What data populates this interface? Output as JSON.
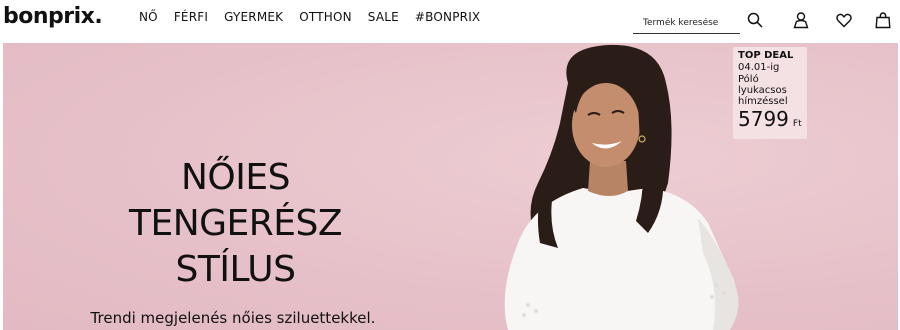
{
  "header": {
    "logo": "bonprix.",
    "nav": [
      "NŐ",
      "FÉRFI",
      "GYERMEK",
      "OTTHON",
      "SALE",
      "#BONPRIX"
    ],
    "search": {
      "placeholder": "Termék keresése",
      "value": ""
    }
  },
  "hero": {
    "title_lines": [
      "NŐIES",
      "TENGERÉSZ",
      "STÍLUS"
    ],
    "subtitle": "Trendi megjelenés nőies sziluettekkel.",
    "deal": {
      "label": "TOP DEAL",
      "date": "04.01-ig",
      "product_lines": [
        "Póló",
        "lyukacsos",
        "hímzéssel"
      ],
      "price": "5799",
      "currency": "Ft"
    }
  },
  "colors": {
    "hero_background": "#e9c6cd",
    "deal_card": "#f4e1e4",
    "text": "#111111"
  }
}
